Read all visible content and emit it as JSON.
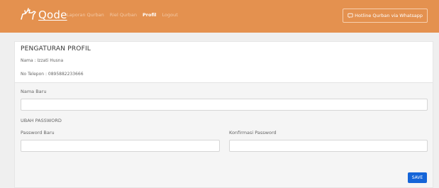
{
  "navbar": {
    "logo_text": "Qode",
    "links": [
      {
        "label": "Laporan Qurban",
        "active": false
      },
      {
        "label": "Riel Qurban",
        "active": false
      },
      {
        "label": "Profil",
        "active": true
      },
      {
        "label": "Logout",
        "active": false
      }
    ],
    "hotline_label": "Hotline Qurban via Whatsapp",
    "background_color": "#e4914f"
  },
  "profile": {
    "title": "PENGATURAN PROFIL",
    "name_line": "Nama : Izzati Husna",
    "phone_line": "No Telepon : 0895882233666"
  },
  "form": {
    "new_name_label": "Nama Baru",
    "new_name_value": "",
    "password_section_label": "UBAH PASSWORD",
    "new_password_label": "Password Baru",
    "new_password_value": "",
    "confirm_password_label": "Konfirmasi Password",
    "confirm_password_value": "",
    "save_label": "SAVE",
    "save_color": "#1565d8"
  }
}
